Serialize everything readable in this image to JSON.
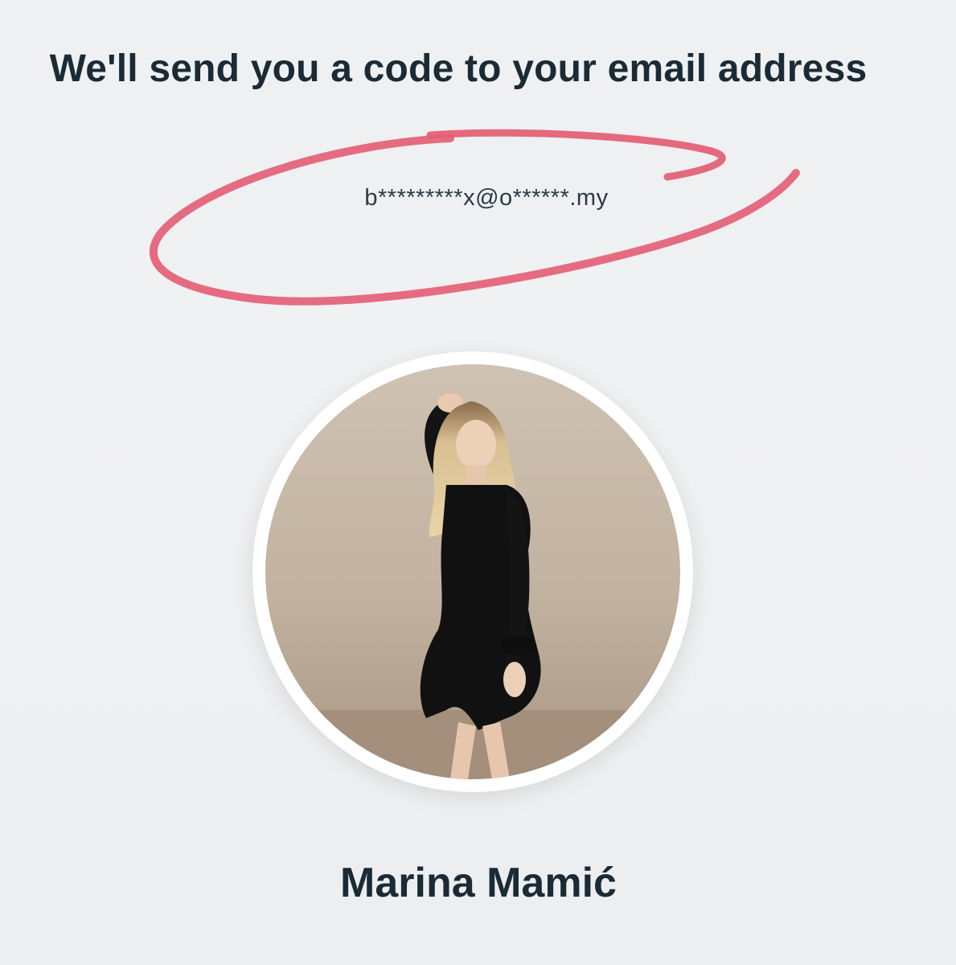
{
  "recovery": {
    "heading": "We'll send you a code to your email address",
    "masked_email": "b*********x@o******.my"
  },
  "profile": {
    "name": "Marina Mamić",
    "avatar_icon": "profile-photo"
  },
  "annotation": {
    "ellipse_color": "#e35d73"
  },
  "colors": {
    "text_primary": "#1b2b35",
    "background": "#eef0f2"
  }
}
